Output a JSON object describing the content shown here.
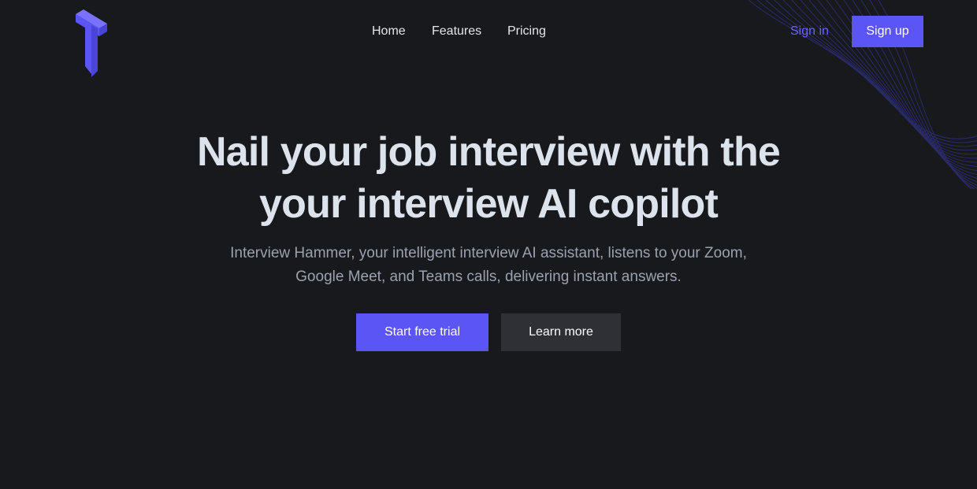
{
  "colors": {
    "background": "#18191c",
    "accent": "#5b55f5",
    "link_accent": "#6b63ff",
    "secondary_button": "#2e3035",
    "heading": "#dde3ec",
    "subtext": "#9aa2b0"
  },
  "header": {
    "logo_icon": "hammer-t-logo",
    "nav": {
      "home": "Home",
      "features": "Features",
      "pricing": "Pricing"
    },
    "sign_in": "Sign in",
    "sign_up": "Sign up"
  },
  "hero": {
    "title_line1": "Nail your job interview with the",
    "title_line2": "your interview AI copilot",
    "subtitle_line1": "Interview Hammer, your intelligent interview AI assistant, listens to your Zoom,",
    "subtitle_line2": "Google Meet, and Teams calls, delivering instant answers.",
    "cta_primary": "Start free trial",
    "cta_secondary": "Learn more"
  },
  "decoration": {
    "background_pattern": "wave-lines-pattern"
  }
}
